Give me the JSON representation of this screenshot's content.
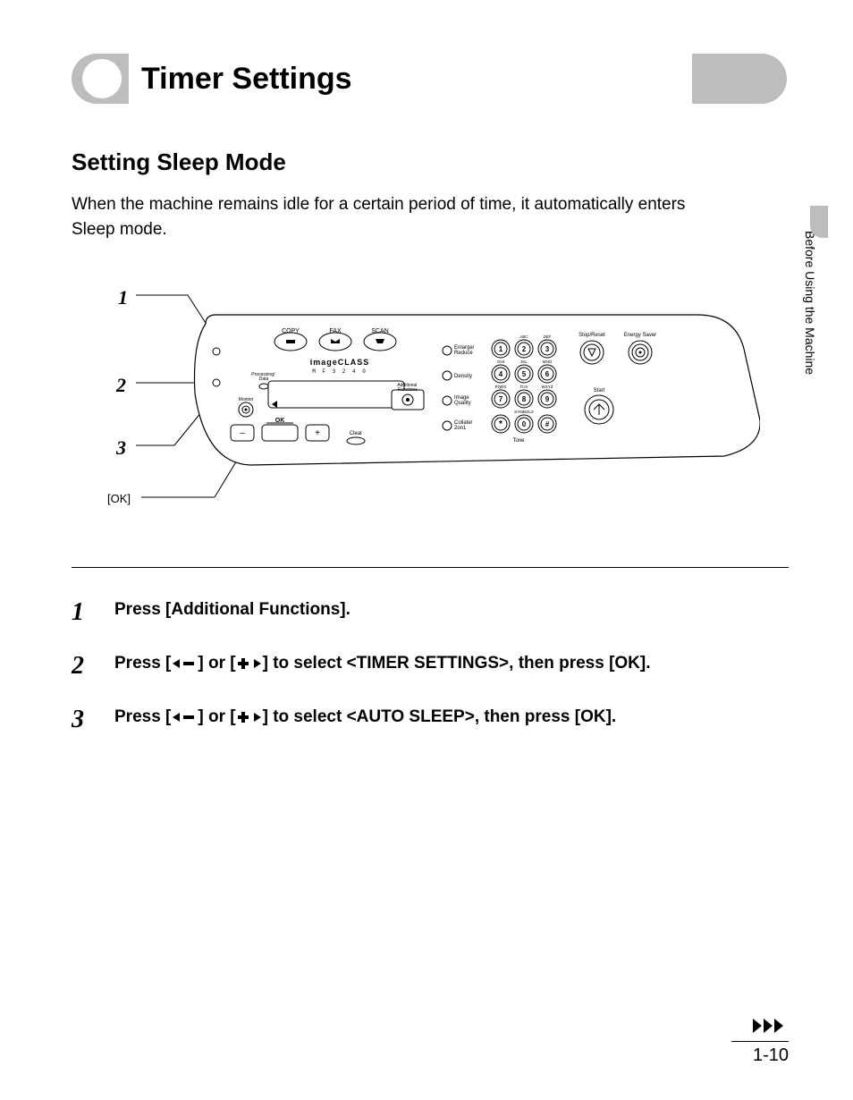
{
  "title": "Timer Settings",
  "section_heading": "Setting Sleep Mode",
  "intro": "When the machine remains idle for a certain period of time, it automatically enters Sleep mode.",
  "side_tab": "Before Using the Machine",
  "panel": {
    "callouts": [
      "1",
      "2",
      "3"
    ],
    "ok_label": "[OK]",
    "mode_buttons": [
      "COPY",
      "FAX",
      "SCAN"
    ],
    "brand_line1": "imageCLASS",
    "brand_line2": "M F 3 2 4 0",
    "proc_data": "Processing/\nData",
    "monitor": "Monitor",
    "ok_key": "OK",
    "lcd_minus": "–",
    "lcd_plus": "+",
    "addl_func": "Additional\nFunctions",
    "clear": "Clear",
    "right_col": [
      "Enlarge/\nReduce",
      "Density",
      "Image\nQuality",
      "Collate/\n2on1"
    ],
    "tone": "Tone",
    "keypad_top": [
      "ABC",
      "DEF",
      "GHI",
      "JKL",
      "MNO",
      "PQRS",
      "TUV",
      "WXYZ",
      "",
      "SYMBOLS",
      ""
    ],
    "keypad": [
      "1",
      "2",
      "3",
      "4",
      "5",
      "6",
      "7",
      "8",
      "9",
      "*",
      "0",
      "#"
    ],
    "stop_reset": "Stop/Reset",
    "energy_saver": "Energy Saver",
    "start": "Start"
  },
  "steps": [
    {
      "n": "1",
      "text_before": "Press [Additional Functions].",
      "has_arrows": false
    },
    {
      "n": "2",
      "text_before": "Press [",
      "mid1": "] or [",
      "mid2": "] to select <TIMER SETTINGS>, then press [OK].",
      "has_arrows": true
    },
    {
      "n": "3",
      "text_before": "Press [",
      "mid1": "] or [",
      "mid2": "] to select <AUTO SLEEP>, then press [OK].",
      "has_arrows": true
    }
  ],
  "page_number": "1-10"
}
